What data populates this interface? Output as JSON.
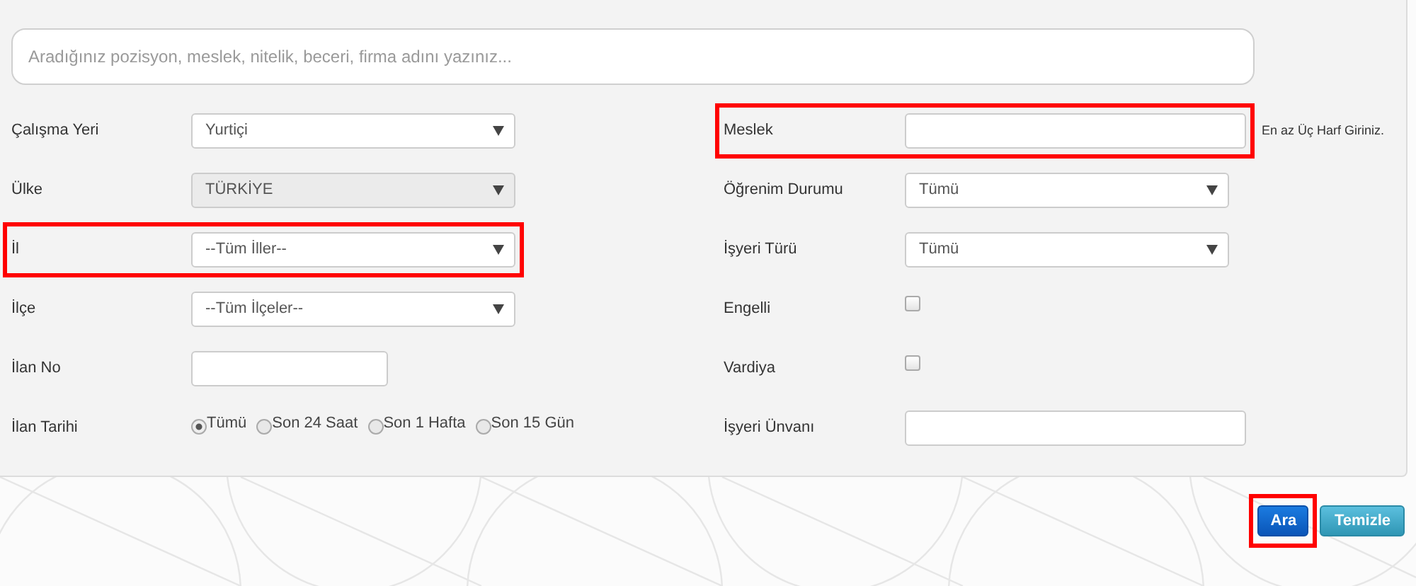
{
  "search": {
    "placeholder": "Aradığınız pozisyon, meslek, nitelik, beceri, firma adını yazınız..."
  },
  "left_fields": [
    {
      "label": "Çalışma Yeri",
      "kind": "select",
      "value": "Yurtiçi",
      "disabled": false,
      "highlighted": false
    },
    {
      "label": "Ülke",
      "kind": "select",
      "value": "TÜRKİYE",
      "disabled": true,
      "highlighted": false
    },
    {
      "label": "İl",
      "kind": "select",
      "value": "--Tüm İller--",
      "disabled": false,
      "highlighted": true
    },
    {
      "label": "İlçe",
      "kind": "select",
      "value": "--Tüm İlçeler--",
      "disabled": false,
      "highlighted": false
    },
    {
      "label": "İlan No",
      "kind": "input",
      "highlighted": false
    },
    {
      "label": "İlan Tarihi",
      "kind": "radio",
      "highlighted": false,
      "options": [
        {
          "label": "Tümü",
          "selected": true
        },
        {
          "label": "Son 24 Saat",
          "selected": false
        },
        {
          "label": "Son 1 Hafta",
          "selected": false
        },
        {
          "label": "Son 15 Gün",
          "selected": false
        }
      ]
    }
  ],
  "right_fields": [
    {
      "label": "Meslek",
      "kind": "input",
      "highlighted": true,
      "note": "En az Üç Harf Giriniz."
    },
    {
      "label": "Öğrenim Durumu",
      "kind": "select",
      "value": "Tümü",
      "disabled": false,
      "highlighted": false
    },
    {
      "label": "İşyeri Türü",
      "kind": "select",
      "value": "Tümü",
      "disabled": false,
      "highlighted": false
    },
    {
      "label": "Engelli",
      "kind": "checkbox",
      "checked": false,
      "highlighted": false
    },
    {
      "label": "Vardiya",
      "kind": "checkbox",
      "checked": false,
      "highlighted": false
    },
    {
      "label": "İşyeri Ünvanı",
      "kind": "input",
      "highlighted": false
    }
  ],
  "buttons": [
    {
      "label": "Ara",
      "kind": "primary",
      "highlighted": true
    },
    {
      "label": "Temizle",
      "kind": "info",
      "highlighted": false
    }
  ]
}
